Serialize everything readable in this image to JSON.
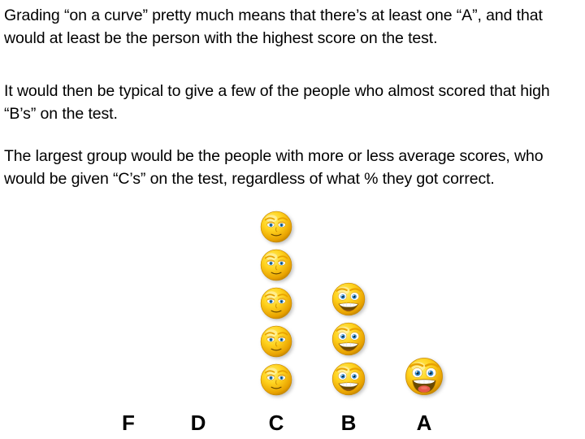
{
  "slide": {
    "background_color": "#ffffff",
    "text_color": "#000000",
    "paragraphs": [
      "Grading “on a curve” pretty much means that there’s at least one “A”, and that would at least be the person with the highest score on the test.",
      "It would then be typical to give a few of the people who almost scored that high “B’s” on the test.",
      "The largest group would be the people with more or less average scores, who would be given “C’s” on the test, regardless of what % they got correct."
    ]
  },
  "chart_data": {
    "type": "bar",
    "title": "",
    "subtitle": "",
    "xlabel": "",
    "ylabel": "",
    "categories": [
      "F",
      "D",
      "C",
      "B",
      "A"
    ],
    "values": [
      0,
      0,
      5,
      3,
      1
    ],
    "ylim": [
      0,
      5
    ],
    "grid": false,
    "legend": null,
    "units": "people (each smiley face = 1 person)",
    "pictogram_icon": "smiley-face-icon",
    "annotations": [],
    "note": "Pictogram bar chart: stacked smiley faces represent the number of students earning each letter grade on a curve."
  },
  "axis": {
    "labels": [
      {
        "text": "F",
        "count": 0,
        "face_style": "none"
      },
      {
        "text": "D",
        "count": 0,
        "face_style": "none"
      },
      {
        "text": "C",
        "count": 5,
        "face_style": "neutral-sleepy"
      },
      {
        "text": "B",
        "count": 3,
        "face_style": "toothy-grin"
      },
      {
        "text": "A",
        "count": 1,
        "face_style": "open-laugh"
      }
    ]
  },
  "colors": {
    "face_highlight": "#FFF06A",
    "face_mid": "#FFD21E",
    "face_edge": "#E8A200",
    "face_outline": "#C98A00",
    "eye_iris": "#2E86C9",
    "eye_white": "#FFFFFF",
    "mouth_dark": "#6B4A00",
    "tongue": "#E8594A",
    "teeth": "#FFFFFF",
    "text": "#000000",
    "background": "#FFFFFF"
  }
}
